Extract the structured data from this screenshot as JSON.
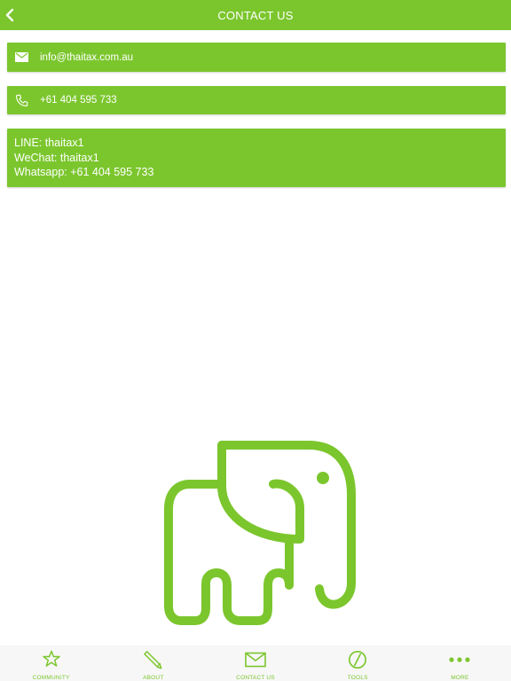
{
  "header": {
    "title": "CONTACT US"
  },
  "contacts": {
    "email": "info@thaitax.com.au",
    "phone": "+61 404 595 733",
    "lines": [
      "LINE: thaitax1",
      "WeChat: thaitax1",
      "Whatsapp: +61 404 595 733"
    ]
  },
  "tabbar": {
    "items": [
      {
        "label": "COMMUNITY",
        "icon": "star-icon"
      },
      {
        "label": "ABOUT",
        "icon": "pencil-icon"
      },
      {
        "label": "CONTACT US",
        "icon": "envelope-icon"
      },
      {
        "label": "TOOLS",
        "icon": "slash-circle-icon"
      },
      {
        "label": "MORE",
        "icon": "more-dots-icon"
      }
    ]
  },
  "colors": {
    "brand": "#7bc62d",
    "tabbar_bg": "#f7f7f7"
  }
}
